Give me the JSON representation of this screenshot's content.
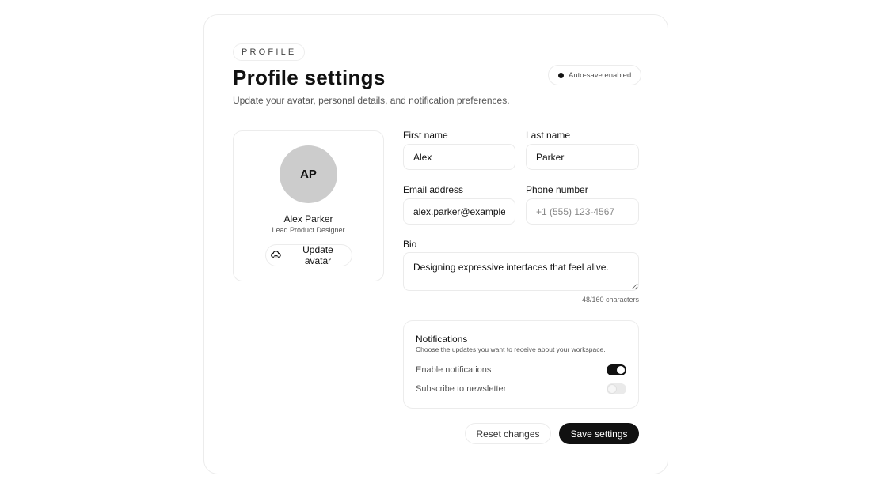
{
  "header": {
    "eyebrow": "PROFILE",
    "title": "Profile settings",
    "subtitle": "Update your avatar, personal details, and notification preferences.",
    "autosave_label": "Auto-save enabled"
  },
  "profile": {
    "initials": "AP",
    "name": "Alex Parker",
    "role": "Lead Product Designer",
    "update_avatar_label": "Update avatar",
    "upload_icon": "upload-cloud-icon"
  },
  "form": {
    "first_name": {
      "label": "First name",
      "value": "Alex",
      "placeholder": ""
    },
    "last_name": {
      "label": "Last name",
      "value": "Parker",
      "placeholder": ""
    },
    "email": {
      "label": "Email address",
      "value": "alex.parker@example.com",
      "placeholder": ""
    },
    "phone": {
      "label": "Phone number",
      "value": "",
      "placeholder": "+1 (555) 123-4567"
    },
    "bio": {
      "label": "Bio",
      "value": "Designing expressive interfaces that feel alive.",
      "counter": "48/160 characters"
    }
  },
  "notifications": {
    "title": "Notifications",
    "description": "Choose the updates you want to receive about your workspace.",
    "toggles": [
      {
        "label": "Enable notifications",
        "on": true
      },
      {
        "label": "Subscribe to newsletter",
        "on": false
      }
    ]
  },
  "actions": {
    "reset_label": "Reset changes",
    "save_label": "Save settings"
  },
  "colors": {
    "accent": "#111111",
    "avatar_bg": "#cccccc",
    "border": "#ececec"
  }
}
